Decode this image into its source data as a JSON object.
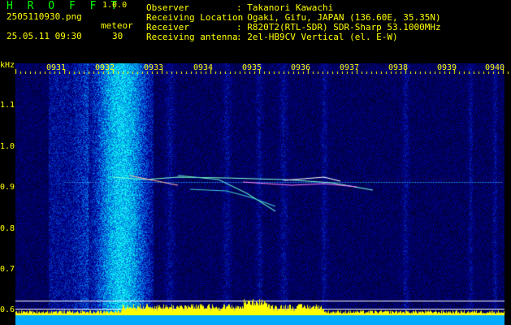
{
  "header": {
    "app_name": "H R O F F T",
    "version": "1.0.0",
    "filename": "2505110930.png",
    "mode": "meteor",
    "datetime": "25.05.11 09:30",
    "count": "30",
    "fields": [
      {
        "label": "Observer",
        "value": ": Takanori Kawachi"
      },
      {
        "label": "Receiving Location",
        "value": ": Ogaki, Gifu, JAPAN (136.60E, 35.35N)"
      },
      {
        "label": "Receiver",
        "value": ": R820T2(RTL-SDR) SDR-Sharp 53.1000MHz"
      },
      {
        "label": "Receiving antenna",
        "value": ": 2el-HB9CV Vertical (el. E-W)"
      }
    ]
  },
  "time_axis": {
    "labels": [
      "0931",
      "0932",
      "0933",
      "0934",
      "0935",
      "0936",
      "0937",
      "0938",
      "0939",
      "0940"
    ]
  },
  "freq_axis": {
    "unit": "kHz",
    "labels": [
      "1.1",
      "1.0",
      "0.9",
      "0.8",
      "0.7",
      "0.6"
    ]
  },
  "colors": {
    "text": "#ffff00",
    "title": "#00ff00",
    "background": "#000000",
    "noise_base": "#0a1a6e",
    "signal": "#00ffff",
    "bottom_bar": "#ffff00"
  }
}
